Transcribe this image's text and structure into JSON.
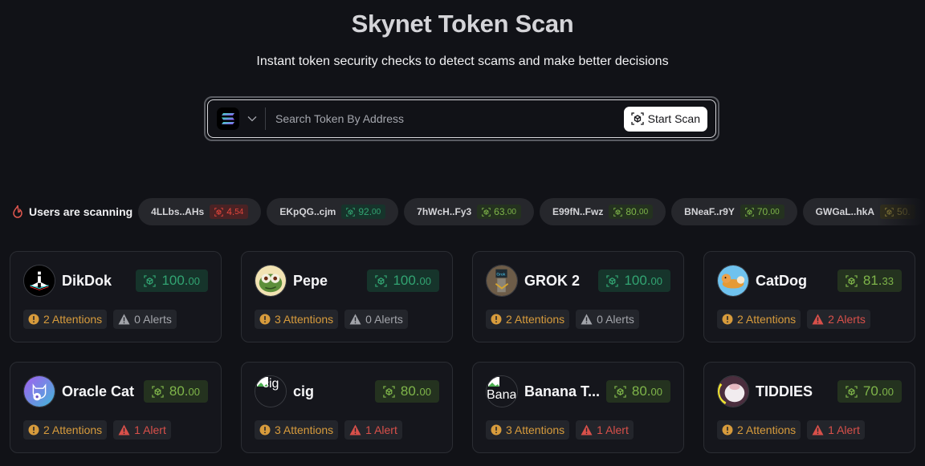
{
  "header": {
    "title": "Skynet Token Scan",
    "subtitle": "Instant token security checks to detect scams and make better decisions"
  },
  "search": {
    "chain": "solana",
    "chain_icon": "solana-logo",
    "placeholder": "Search Token By Address",
    "value": "",
    "button_label": "Start Scan",
    "button_icon": "scan-cube-icon"
  },
  "ticker": {
    "label": "Users are scanning",
    "icon": "fire-icon",
    "items": [
      {
        "address": "4LLbs..AHs",
        "score_int": "4.",
        "score_dec": "54",
        "tone": "red",
        "color": "#e3463c"
      },
      {
        "address": "EKpQG..cjm",
        "score_int": "92.",
        "score_dec": "00",
        "tone": "teal",
        "color": "#32a472"
      },
      {
        "address": "7hWcH..Fy3",
        "score_int": "63.",
        "score_dec": "00",
        "tone": "lime",
        "color": "#7fb54a"
      },
      {
        "address": "E99fN..Fwz",
        "score_int": "80.",
        "score_dec": "00",
        "tone": "lime",
        "color": "#7fb54a"
      },
      {
        "address": "BNeaF..r9Y",
        "score_int": "70.",
        "score_dec": "00",
        "tone": "lime",
        "color": "#7fb54a"
      },
      {
        "address": "GWGaL..hkA",
        "score_int": "50.",
        "score_dec": "",
        "tone": "olive",
        "color": "#9e8e3f"
      }
    ]
  },
  "tokens": [
    {
      "name": "DikDok",
      "avatar": "dikdok-logo",
      "score_int": "100.",
      "score_dec": "00",
      "tone": "teal",
      "attentions": "2 Attentions",
      "alerts": "0 Alerts",
      "alert_level": "none"
    },
    {
      "name": "Pepe",
      "avatar": "pepe-logo",
      "score_int": "100.",
      "score_dec": "00",
      "tone": "teal",
      "attentions": "3 Attentions",
      "alerts": "0 Alerts",
      "alert_level": "none"
    },
    {
      "name": "GROK 2",
      "avatar": "grok2-logo",
      "score_int": "100.",
      "score_dec": "00",
      "tone": "teal",
      "attentions": "2 Attentions",
      "alerts": "0 Alerts",
      "alert_level": "none"
    },
    {
      "name": "CatDog",
      "avatar": "catdog-logo",
      "score_int": "81.",
      "score_dec": "33",
      "tone": "lime",
      "attentions": "2 Attentions",
      "alerts": "2 Alerts",
      "alert_level": "some"
    },
    {
      "name": "Oracle Cat",
      "avatar": "oracle-cat-logo",
      "score_int": "80.",
      "score_dec": "00",
      "tone": "lime",
      "attentions": "2 Attentions",
      "alerts": "1 Alert",
      "alert_level": "some"
    },
    {
      "name": "cig",
      "avatar": "cig-broken-image",
      "avatar_alt": "cig",
      "score_int": "80.",
      "score_dec": "00",
      "tone": "lime",
      "attentions": "3 Attentions",
      "alerts": "1 Alert",
      "alert_level": "some"
    },
    {
      "name": "Banana T...",
      "avatar": "banana-broken-image",
      "avatar_alt": "Bana",
      "score_int": "80.",
      "score_dec": "00",
      "tone": "lime",
      "attentions": "3 Attentions",
      "alerts": "1 Alert",
      "alert_level": "some"
    },
    {
      "name": "TIDDIES",
      "avatar": "tiddies-logo",
      "score_int": "70.",
      "score_dec": "00",
      "tone": "lime",
      "attentions": "2 Attentions",
      "alerts": "1 Alert",
      "alert_level": "some"
    }
  ]
}
